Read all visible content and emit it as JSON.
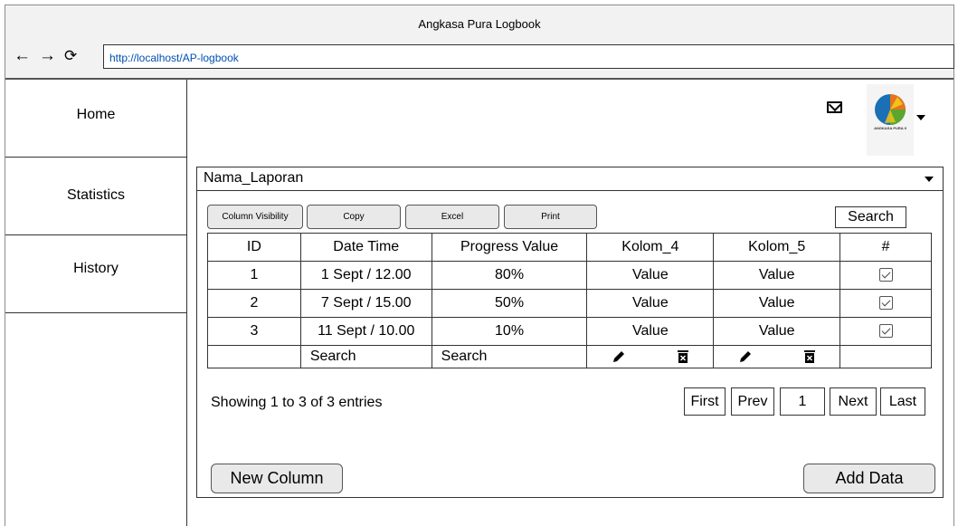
{
  "window": {
    "title": "Angkasa Pura Logbook",
    "back_icon": "←",
    "forward_icon": "→",
    "reload_icon": "⟳",
    "url": "http://localhost/AP-logbook"
  },
  "sidebar": {
    "items": [
      {
        "label": "Home"
      },
      {
        "label": "Statistics"
      },
      {
        "label": "History"
      }
    ]
  },
  "header": {
    "mail_icon": "mail-icon",
    "avatar_logo_text": "ANGKASA PURA II"
  },
  "report": {
    "selected": "Nama_Laporan"
  },
  "toolbar": {
    "column_visibility": "Column Visibility",
    "copy": "Copy",
    "excel": "Excel",
    "print": "Print",
    "search": "Search"
  },
  "table": {
    "headers": [
      "ID",
      "Date Time",
      "Progress Value",
      "Kolom_4",
      "Kolom_5",
      "#"
    ],
    "rows": [
      {
        "id": "1",
        "datetime": "1 Sept / 12.00",
        "progress": "80%",
        "k4": "Value",
        "k5": "Value",
        "checked": true
      },
      {
        "id": "2",
        "datetime": "7 Sept / 15.00",
        "progress": "50%",
        "k4": "Value",
        "k5": "Value",
        "checked": true
      },
      {
        "id": "3",
        "datetime": "11 Sept / 10.00",
        "progress": "10%",
        "k4": "Value",
        "k5": "Value",
        "checked": true
      }
    ],
    "search_row": {
      "datetime": "Search",
      "progress": "Search"
    }
  },
  "footer": {
    "entries_text": "Showing 1 to 3 of 3 entries",
    "pagination": {
      "first": "First",
      "prev": "Prev",
      "page": "1",
      "next": "Next",
      "last": "Last"
    },
    "new_column": "New Column",
    "add_data": "Add Data"
  },
  "colors": {
    "titlebar_bg": "#f2f2f2",
    "button_bg": "#e9e9e9",
    "url_text": "#0050b3",
    "logo_blue": "#1a6fb5",
    "logo_green": "#5aa62e",
    "logo_orange": "#e8731c",
    "logo_yellow": "#f2c318"
  }
}
